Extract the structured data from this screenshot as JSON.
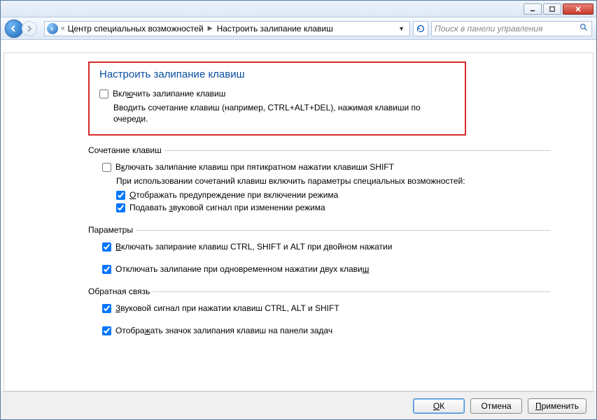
{
  "breadcrumb": {
    "parent": "Центр специальных возможностей",
    "current": "Настроить залипание клавиш"
  },
  "search": {
    "placeholder": "Поиск в панели управления"
  },
  "main": {
    "title": "Настроить залипание клавиш",
    "enable_label_pre": "Вкл",
    "enable_label_u": "ю",
    "enable_label_post": "чить залипание клавиш",
    "enable_desc": "Вводить сочетание клавиш (например, CTRL+ALT+DEL), нажимая клавиши по очереди."
  },
  "group_shortcut": {
    "legend": "Сочетание клавиш",
    "opt1_pre": "В",
    "opt1_u": "к",
    "opt1_post": "лючать залипание клавиш при пятикратном нажатии клавиши SHIFT",
    "subtext": "При использовании сочетаний клавиш включить параметры специальных возможностей:",
    "opt2_u": "О",
    "opt2_post": "тображать предупреждение при включении режима",
    "opt3_pre": "Подавать ",
    "opt3_u": "з",
    "opt3_post": "вуковой сигнал при изменении режима"
  },
  "group_params": {
    "legend": "Параметры",
    "opt1_u": "В",
    "opt1_post": "ключать запирание клавиш CTRL, SHIFT и ALT при двойном нажатии",
    "opt2_pre": "Отключать залипание при одновременном нажатии двух клави",
    "opt2_u": "ш"
  },
  "group_feedback": {
    "legend": "Обратная связь",
    "opt1_u": "З",
    "opt1_post": "вуковой сигнал при нажатии клавиш CTRL, ALT и SHIFT",
    "opt2_pre": "Отобра",
    "opt2_u": "ж",
    "opt2_post": "ать значок залипания клавиш на панели задач"
  },
  "buttons": {
    "ok_u": "О",
    "ok_post": "К",
    "cancel": "Отмена",
    "apply_u": "П",
    "apply_post": "рименить"
  }
}
